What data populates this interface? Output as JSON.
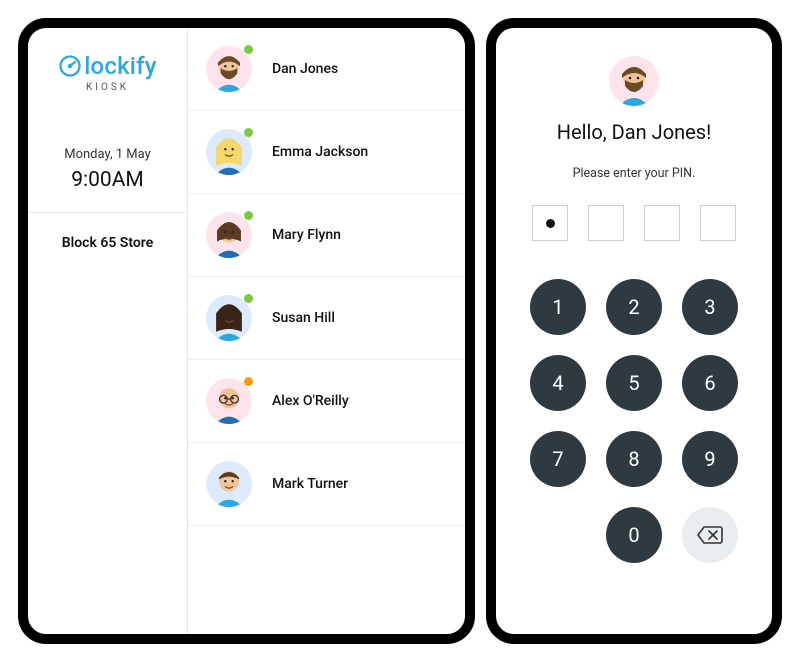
{
  "brand": {
    "name": "lockify",
    "sub": "KIOSK"
  },
  "date": "Monday, 1 May",
  "time": "9:00AM",
  "location": "Block 65 Store",
  "status_colors": {
    "online": "#7ac943",
    "away": "#ff9a00"
  },
  "people": [
    {
      "name": "Dan Jones",
      "status": "online",
      "avatar_bg": "#fde4ea",
      "hair": "#6b4a2a",
      "skin": "#f2c49a",
      "shirt": "#2aa8e0",
      "style": "beard"
    },
    {
      "name": "Emma Jackson",
      "status": "online",
      "avatar_bg": "#dceafe",
      "hair": "#f4d86a",
      "skin": "#f6d2b0",
      "shirt": "#1e6fb8",
      "style": "longhair"
    },
    {
      "name": "Mary Flynn",
      "status": "online",
      "avatar_bg": "#fde4ea",
      "hair": "#5a3b23",
      "skin": "#f2c49a",
      "shirt": "#1e6fb8",
      "style": "bob"
    },
    {
      "name": "Susan Hill",
      "status": "online",
      "avatar_bg": "#dceafe",
      "hair": "#3a2415",
      "skin": "#f2c49a",
      "shirt": "#2aa8e0",
      "style": "longhair"
    },
    {
      "name": "Alex O'Reilly",
      "status": "away",
      "avatar_bg": "#fde4ea",
      "hair": "#d8d8d8",
      "skin": "#f2c49a",
      "shirt": "#1e6fb8",
      "style": "bald_glasses"
    },
    {
      "name": "Mark Turner",
      "status": "",
      "avatar_bg": "#dceafe",
      "hair": "#5a3b23",
      "skin": "#f2c49a",
      "shirt": "#2aa8e0",
      "style": "short"
    }
  ],
  "pin": {
    "selected_person_index": 0,
    "greeting_prefix": "Hello, ",
    "greeting_suffix": "!",
    "instruction": "Please enter your PIN.",
    "entered_count": 1,
    "length": 4,
    "keys": [
      "1",
      "2",
      "3",
      "4",
      "5",
      "6",
      "7",
      "8",
      "9",
      "0"
    ]
  }
}
